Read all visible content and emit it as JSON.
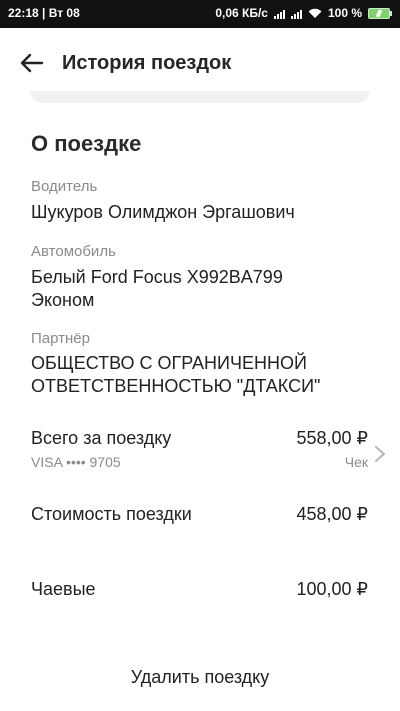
{
  "status_bar": {
    "time_day": "22:18 | Вт 08",
    "net_speed": "0,06 КБ/с",
    "battery_percent": "100 %"
  },
  "app_bar": {
    "back_icon": "arrow-left-icon",
    "title": "История поездок"
  },
  "trip": {
    "section_title": "О поездке",
    "driver": {
      "label": "Водитель",
      "value": "Шукуров Олимджон Эргашович"
    },
    "car": {
      "label": "Автомобиль",
      "line1": "Белый Ford Focus X992BA799",
      "line2": "Эконом"
    },
    "partner": {
      "label": "Партнёр",
      "line1": "ОБЩЕСТВО С ОГРАНИЧЕННОЙ",
      "line2": "ОТВЕТСТВЕННОСТЬЮ \"ДТАКСИ\""
    },
    "total": {
      "label": "Всего за поездку",
      "amount": "558,00 ₽",
      "card": "VISA •••• 9705",
      "receipt": "Чек"
    },
    "cost": {
      "label": "Стоимость поездки",
      "amount": "458,00 ₽"
    },
    "tips": {
      "label": "Чаевые",
      "amount": "100,00 ₽"
    }
  },
  "actions": {
    "delete_label": "Удалить поездку"
  }
}
